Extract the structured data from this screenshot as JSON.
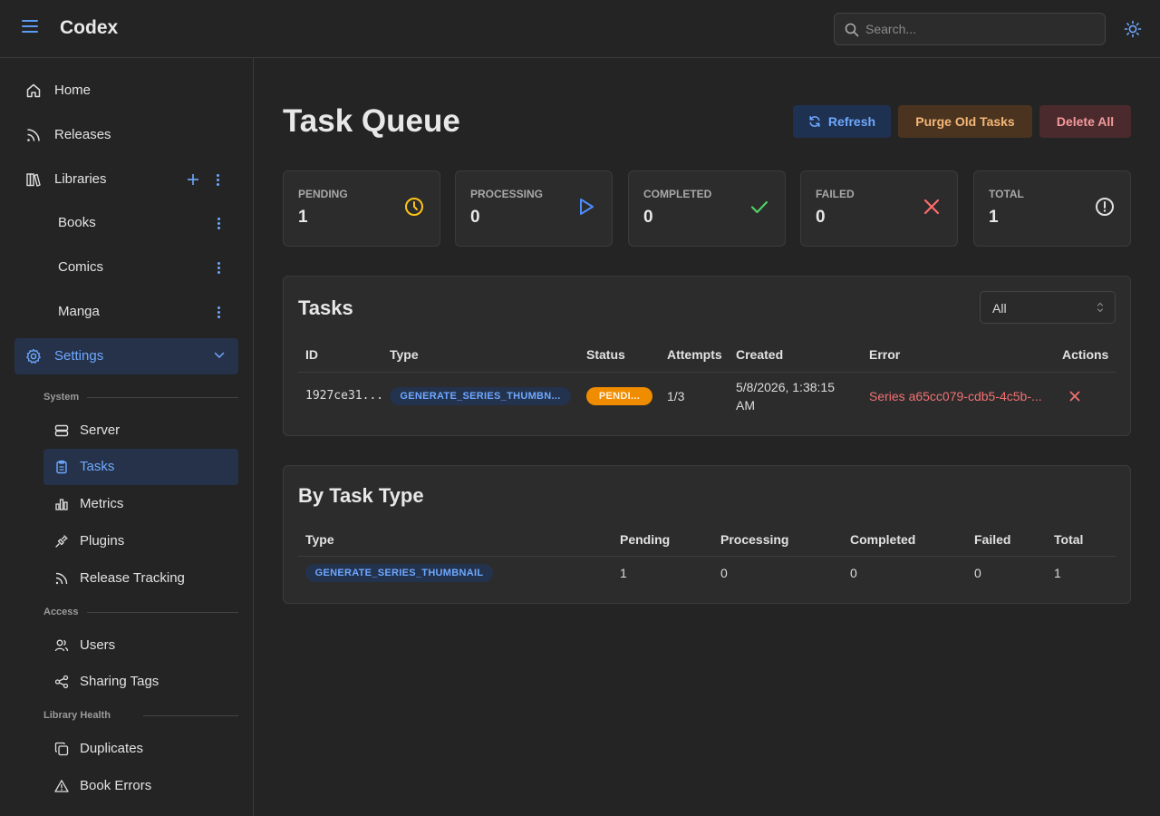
{
  "app": {
    "title": "Codex"
  },
  "header": {
    "search_placeholder": "Search..."
  },
  "sidebar": {
    "home": "Home",
    "releases": "Releases",
    "libraries": "Libraries",
    "library_items": [
      "Books",
      "Comics",
      "Manga"
    ],
    "settings": "Settings",
    "sections": {
      "system": "System",
      "access": "Access",
      "library_health": "Library Health"
    },
    "system_items": [
      "Server",
      "Tasks",
      "Metrics",
      "Plugins",
      "Release Tracking"
    ],
    "access_items": [
      "Users",
      "Sharing Tags"
    ],
    "health_items": [
      "Duplicates",
      "Book Errors"
    ]
  },
  "page": {
    "title": "Task Queue",
    "buttons": {
      "refresh": "Refresh",
      "purge": "Purge Old Tasks",
      "delete_all": "Delete All"
    }
  },
  "stats": [
    {
      "label": "PENDING",
      "value": "1",
      "icon": "clock-icon",
      "color": "#fcc419"
    },
    {
      "label": "PROCESSING",
      "value": "0",
      "icon": "play-icon",
      "color": "#4c8dff"
    },
    {
      "label": "COMPLETED",
      "value": "0",
      "icon": "check-icon",
      "color": "#51cf66"
    },
    {
      "label": "FAILED",
      "value": "0",
      "icon": "x-icon",
      "color": "#ff6b6b"
    },
    {
      "label": "TOTAL",
      "value": "1",
      "icon": "alert-circle-icon",
      "color": "#e0e0e0"
    }
  ],
  "tasks": {
    "title": "Tasks",
    "filter": "All",
    "columns": [
      "ID",
      "Type",
      "Status",
      "Attempts",
      "Created",
      "Error",
      "Actions"
    ],
    "rows": [
      {
        "id": "1927ce31...",
        "type": "GENERATE_SERIES_THUMBN...",
        "status": "PENDI...",
        "attempts": "1/3",
        "created_line1": "5/8/2026, 1:38:15",
        "created_line2": "AM",
        "error": "Series a65cc079-cdb5-4c5b-..."
      }
    ]
  },
  "by_type": {
    "title": "By Task Type",
    "columns": [
      "Type",
      "Pending",
      "Processing",
      "Completed",
      "Failed",
      "Total"
    ],
    "rows": [
      {
        "type": "GENERATE_SERIES_THUMBNAIL",
        "pending": "1",
        "processing": "0",
        "completed": "0",
        "failed": "0",
        "total": "1"
      }
    ]
  }
}
